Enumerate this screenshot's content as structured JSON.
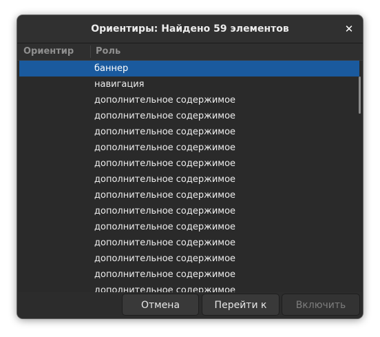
{
  "window": {
    "title": "Ориентиры: Найдено 59 элементов",
    "close_glyph": "✕"
  },
  "list": {
    "columns": [
      "Ориентир",
      "Роль"
    ],
    "rows": [
      "баннер",
      "навигация",
      "дополнительное содержимое",
      "дополнительное содержимое",
      "дополнительное содержимое",
      "дополнительное содержимое",
      "дополнительное содержимое",
      "дополнительное содержимое",
      "дополнительное содержимое",
      "дополнительное содержимое",
      "дополнительное содержимое",
      "дополнительное содержимое",
      "дополнительное содержимое",
      "дополнительное содержимое",
      "дополнительное содержимое"
    ],
    "selected_index": 0
  },
  "buttons": {
    "cancel": "Отмена",
    "goto": "Перейти к",
    "activate": "Включить"
  },
  "colors": {
    "selection": "#1a5a9e",
    "background": "#2a2a2a"
  }
}
